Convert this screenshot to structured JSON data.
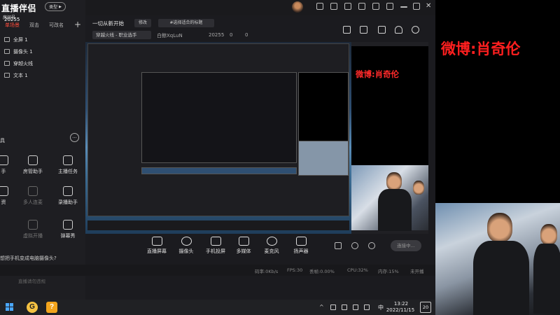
{
  "app": {
    "logo": "直播伴侣",
    "logo_sub": "房间号",
    "room_id": "20255",
    "type_button": "类型"
  },
  "scene_tabs": [
    "单场景",
    "双击",
    "可改名"
  ],
  "sources": [
    {
      "name": "全屏 1",
      "icon": "monitor-icon"
    },
    {
      "name": "摄像头 1",
      "icon": "camera-icon"
    },
    {
      "name": "穿越火线",
      "icon": "game-icon"
    },
    {
      "name": "文本 1",
      "icon": "text-icon"
    }
  ],
  "tools": {
    "title": "具",
    "items": [
      {
        "label": "手",
        "icon": "hand-icon"
      },
      {
        "label": "房管助手",
        "icon": "room-admin-icon"
      },
      {
        "label": "主播任务",
        "icon": "task-icon"
      },
      {
        "label": "资",
        "icon": "resource-icon"
      },
      {
        "label": "多人连麦",
        "icon": "multi-mic-icon"
      },
      {
        "label": "录播助手",
        "icon": "record-icon"
      },
      {
        "label": "虚拟开播",
        "icon": "virtual-icon"
      },
      {
        "label": "弹幕秀",
        "icon": "danmaku-icon"
      }
    ],
    "tip": "想把手机变成电脑摄像头?"
  },
  "room": {
    "title": "一切从新开始",
    "edit_label": "修改",
    "tag_label": "#选择适合的标题",
    "category": "穿越火线 - 职业选手",
    "host": "白鲸XqLuN",
    "fans": "20255",
    "likes": "0",
    "viewers": "0"
  },
  "controls": [
    {
      "label": "直播屏幕",
      "icon": "screen-share-icon"
    },
    {
      "label": "摄像头",
      "icon": "webcam-icon"
    },
    {
      "label": "手机投屏",
      "icon": "phone-cast-icon"
    },
    {
      "label": "多媒体",
      "icon": "media-icon"
    },
    {
      "label": "麦克风",
      "icon": "microphone-icon"
    },
    {
      "label": "扬声器",
      "icon": "speaker-icon"
    }
  ],
  "start_live": "连接中...",
  "status": {
    "bitrate": "码率:0Kb/s",
    "fps": "FPS:30",
    "dropped": "丢帧:0.00%",
    "cpu": "CPU:32%",
    "memory": "内存:15%",
    "live_state": "未开播"
  },
  "warning": "直播请勿违规",
  "monitor": {
    "weibo_text": "微博:肖奇伦"
  },
  "overlay": {
    "weibo_text": "微博:肖奇伦"
  },
  "taskbar": {
    "app1_letter": "G",
    "app2_letter": "?",
    "ime": "中",
    "time": "13:22",
    "date": "2022/11/15",
    "notify_count": "20"
  },
  "colors": {
    "accent": "#ff4d3d",
    "weibo_red": "#ff1f1f",
    "background": "#1b1b1f"
  }
}
